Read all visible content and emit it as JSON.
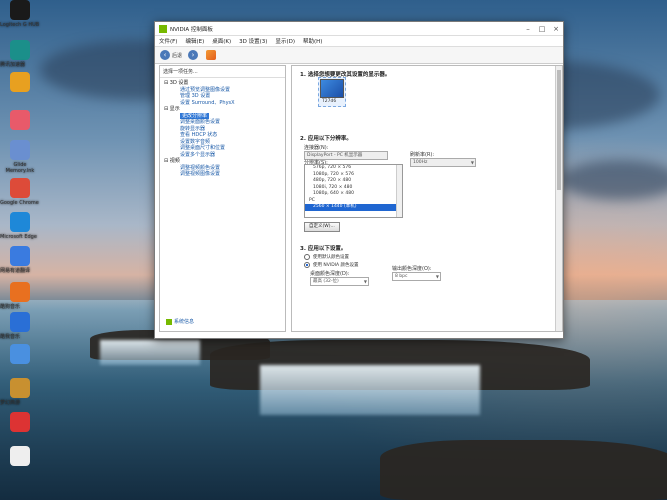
{
  "window": {
    "title": "NVIDIA 控制面板",
    "menu": [
      "文件(F)",
      "编辑(E)",
      "桌面(K)",
      "3D 设置(3)",
      "显示(D)",
      "帮助(H)"
    ],
    "back_label": "后退"
  },
  "leftpane": {
    "task_header": "选择一项任务...",
    "tree": [
      {
        "type": "cat",
        "label": "3D 设置"
      },
      {
        "type": "item",
        "label": "通过预览调整图像设置"
      },
      {
        "type": "item",
        "label": "管理 3D 设置"
      },
      {
        "type": "item",
        "label": "设置 Surround、PhysX"
      },
      {
        "type": "cat",
        "label": "显示"
      },
      {
        "type": "item",
        "label": "更改分辨率",
        "selected": true
      },
      {
        "type": "item",
        "label": "调整桌面颜色设置"
      },
      {
        "type": "item",
        "label": "旋转显示器"
      },
      {
        "type": "item",
        "label": "查看 HDCP 状态"
      },
      {
        "type": "item",
        "label": "设置数字音频"
      },
      {
        "type": "item",
        "label": "调整桌面尺寸和位置"
      },
      {
        "type": "item",
        "label": "设置多个显示器"
      },
      {
        "type": "cat",
        "label": "视频"
      },
      {
        "type": "item",
        "label": "调整视频颜色设置"
      },
      {
        "type": "item",
        "label": "调整视频图像设置"
      }
    ],
    "system_info_link": "系统信息"
  },
  "rightpane": {
    "step1": "1. 选择您想要更改其设置的显示器。",
    "monitor_label": "T27d6",
    "step2": "2. 应用以下分辨率。",
    "connector_label": "连接器(N):",
    "connector_value": "DisplayPort - PC 机显示器",
    "resolution_label": "分辨率(S):",
    "refresh_label": "刷新率(R):",
    "refresh_value": "100Hz",
    "resolutions": [
      "576p, 720 × 576",
      "1080p, 720 × 576",
      "480p, 720 × 480",
      "1080i, 720 × 480",
      "1080p, 640 × 480",
      "PC",
      "2560 × 1440 (本机)"
    ],
    "selected_index": 6,
    "header_index": 5,
    "customize_button": "自定义(W)...",
    "step3": "3. 应用以下设置。",
    "radio_default": "使用默认颜色设置",
    "radio_nvidia": "使用 NVIDIA 颜色设置",
    "radio_selected": "nvidia",
    "desktop_depth_label": "桌面颜色深度(D):",
    "desktop_depth_value": "最高 (32-位)",
    "output_depth_label": "输出颜色深度(O):",
    "output_depth_value": "8 bpc"
  },
  "desktop_icons": [
    {
      "label": "Logitech G HUB",
      "color": "#1a1a1a"
    },
    {
      "label": "腾讯加速器",
      "color": "#1b8f8a"
    },
    {
      "label": "",
      "color": "#e8a020"
    },
    {
      "label": "",
      "color": "#e85a6a"
    },
    {
      "label": "Glide Memory.lnk",
      "color": "#6a8fd0"
    },
    {
      "label": "Google Chrome",
      "color": "#dd4b39"
    },
    {
      "label": "Microsoft Edge",
      "color": "#1e88d8"
    },
    {
      "label": "网易有道翻译",
      "color": "#3a7be0"
    },
    {
      "label": "酷狗音乐",
      "color": "#e87020"
    },
    {
      "label": "酷我音乐",
      "color": "#2a6fd6"
    },
    {
      "label": "",
      "color": "#4a90e0"
    },
    {
      "label": "梦幻西游",
      "color": "#c89030"
    },
    {
      "label": "",
      "color": "#d33"
    },
    {
      "label": "",
      "color": "#eee"
    }
  ]
}
